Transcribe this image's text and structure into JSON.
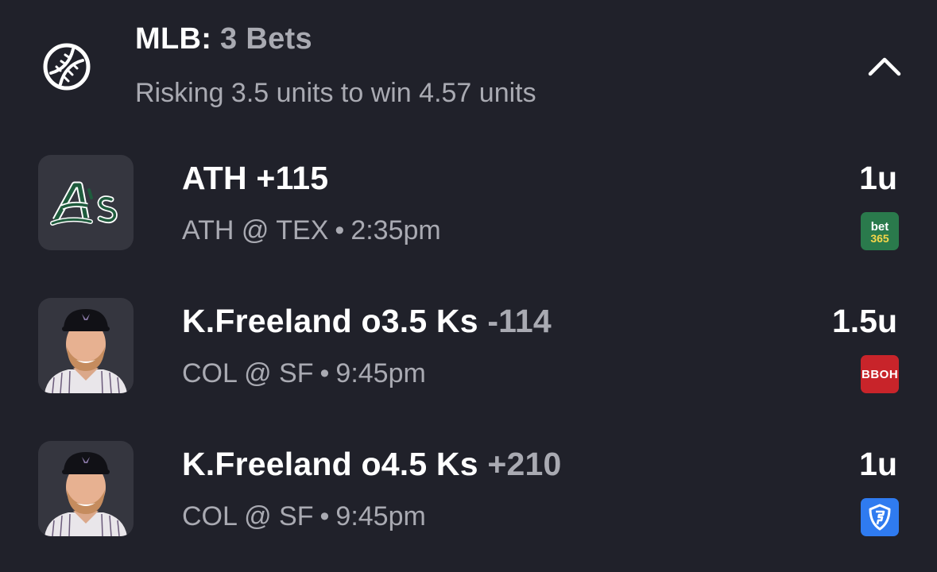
{
  "header": {
    "sport": "MLB:",
    "bet_count": "3 Bets",
    "summary": "Risking 3.5 units to win 4.57 units",
    "sport_icon": "baseball-icon",
    "collapse_icon": "chevron-up-icon"
  },
  "bets": [
    {
      "pick": "ATH",
      "odds": "+115",
      "odds_muted": false,
      "matchup": "ATH @ TEX",
      "separator": "•",
      "time": "2:35pm",
      "units": "1u",
      "avatar": "athletics-logo",
      "sportsbook": "bet365",
      "book_text_1": "bet",
      "book_text_2": "365",
      "book_color": "#2a7a4c"
    },
    {
      "pick": "K.Freeland o3.5 Ks",
      "odds": "-114",
      "odds_muted": true,
      "matchup": "COL @ SF",
      "separator": "•",
      "time": "9:45pm",
      "units": "1.5u",
      "avatar": "player-headshot",
      "sportsbook": "bboh",
      "book_text_1": "BBOH",
      "book_color": "#c8242a"
    },
    {
      "pick": "K.Freeland o4.5 Ks",
      "odds": "+210",
      "odds_muted": true,
      "matchup": "COL @ SF",
      "separator": "•",
      "time": "9:45pm",
      "units": "1u",
      "avatar": "player-headshot",
      "sportsbook": "fanduel",
      "book_icon": "fanduel-shield-icon",
      "book_color": "#2f7bf0"
    }
  ],
  "colors": {
    "background": "#20212a",
    "muted_text": "#a9aab2",
    "tile": "#35363f"
  }
}
